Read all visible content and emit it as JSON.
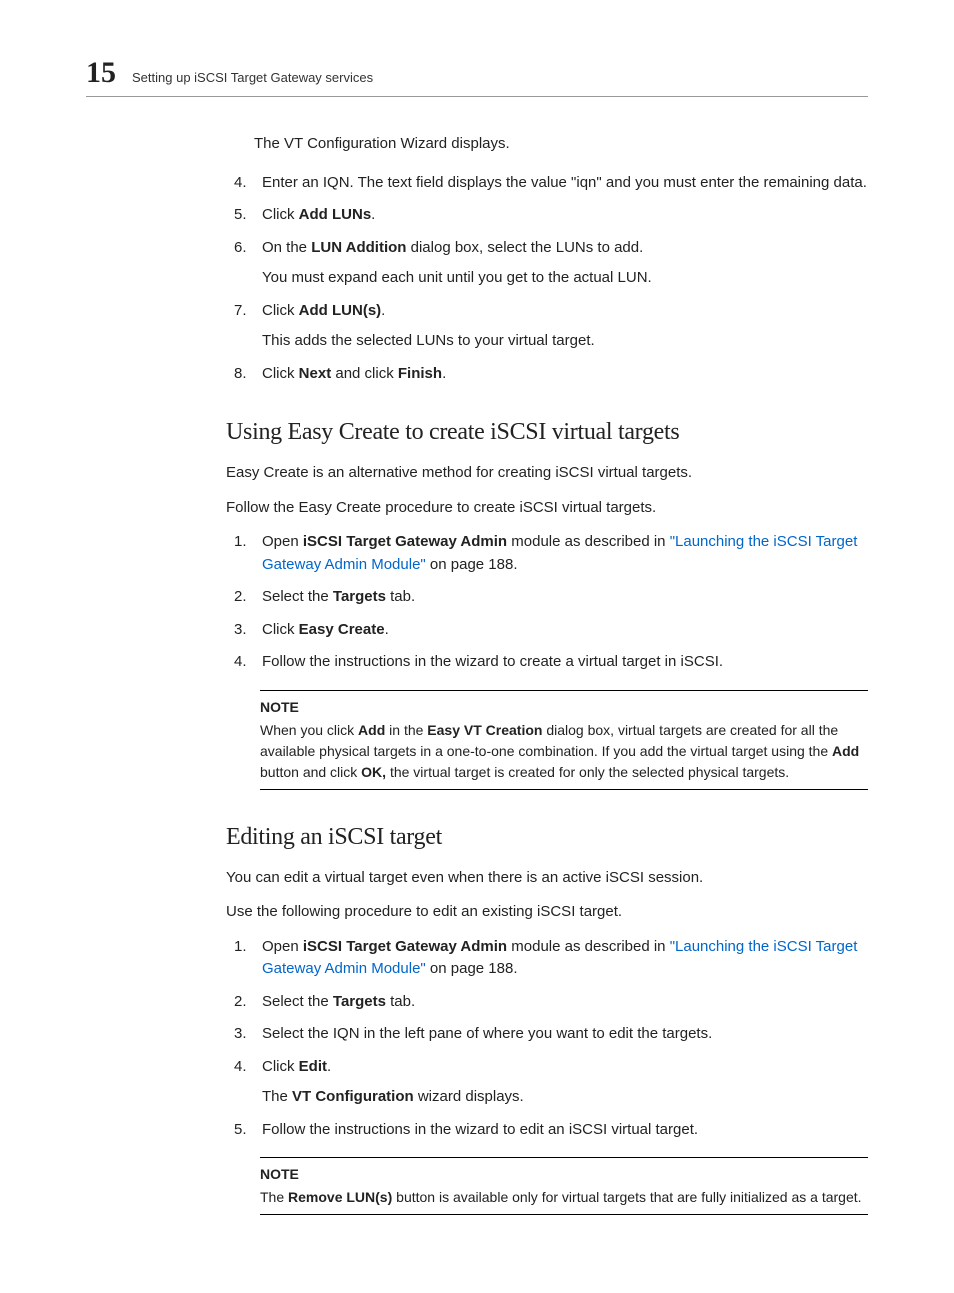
{
  "header": {
    "chapter_number": "15",
    "title": "Setting up iSCSI Target Gateway services"
  },
  "intro_line": "The VT Configuration Wizard displays.",
  "top_steps": {
    "s4": {
      "num": "4.",
      "text_a": "Enter an IQN. The text field displays the value \"iqn\" and you must enter the remaining data."
    },
    "s5": {
      "num": "5.",
      "text_a": "Click ",
      "bold_a": "Add LUNs",
      "text_b": "."
    },
    "s6": {
      "num": "6.",
      "text_a": "On the ",
      "bold_a": "LUN Addition",
      "text_b": " dialog box, select the LUNs to add.",
      "para_b": "You must expand each unit until you get to the actual LUN."
    },
    "s7": {
      "num": "7.",
      "text_a": "Click ",
      "bold_a": "Add LUN(s)",
      "text_b": ".",
      "para_b": "This adds the selected LUNs to your virtual target."
    },
    "s8": {
      "num": "8.",
      "text_a": "Click ",
      "bold_a": "Next",
      "text_b": " and click ",
      "bold_b": "Finish",
      "text_c": "."
    }
  },
  "section1": {
    "heading": "Using Easy Create to create iSCSI virtual targets",
    "p1": "Easy Create is an alternative method for creating iSCSI virtual targets.",
    "p2": "Follow the Easy Create procedure to create iSCSI virtual targets.",
    "steps": {
      "s1": {
        "num": "1.",
        "a": "Open ",
        "b": "iSCSI Target Gateway Admin",
        "c": " module as described in ",
        "link": "\"Launching the iSCSI Target Gateway Admin Module\"",
        "d": " on page 188."
      },
      "s2": {
        "num": "2.",
        "a": "Select the ",
        "b": "Targets",
        "c": " tab."
      },
      "s3": {
        "num": "3.",
        "a": "Click ",
        "b": "Easy Create",
        "c": "."
      },
      "s4": {
        "num": "4.",
        "a": "Follow the instructions in the wizard to create a virtual target in iSCSI."
      }
    },
    "note": {
      "label": "NOTE",
      "a": "When you click ",
      "b": "Add",
      "c": " in the ",
      "d": "Easy VT Creation",
      "e": " dialog box, virtual targets are created for all the available physical targets in a one-to-one combination. If you add the virtual target using the ",
      "f": "Add",
      "g": " button and click ",
      "h": "OK,",
      "i": " the virtual target is created for only the selected physical targets."
    }
  },
  "section2": {
    "heading": "Editing an iSCSI target",
    "p1": "You can edit a virtual target even when there is an active iSCSI session.",
    "p2": "Use the following procedure to edit an existing iSCSI target.",
    "steps": {
      "s1": {
        "num": "1.",
        "a": "Open ",
        "b": "iSCSI Target Gateway Admin",
        "c": " module as described in ",
        "link": "\"Launching the iSCSI Target Gateway Admin Module\"",
        "d": " on page 188."
      },
      "s2": {
        "num": "2.",
        "a": "Select the ",
        "b": "Targets",
        "c": " tab."
      },
      "s3": {
        "num": "3.",
        "a": "Select the IQN in the left pane of where you want to edit the targets."
      },
      "s4": {
        "num": "4.",
        "a": "Click ",
        "b": "Edit",
        "c": ".",
        "para_b_a": "The ",
        "para_b_b": "VT Configuration",
        "para_b_c": " wizard displays."
      },
      "s5": {
        "num": "5.",
        "a": "Follow the instructions in the wizard to edit an iSCSI virtual target."
      }
    },
    "note": {
      "label": "NOTE",
      "a": "The ",
      "b": "Remove LUN(s)",
      "c": " button is available only for virtual targets that are fully initialized as a target."
    }
  }
}
